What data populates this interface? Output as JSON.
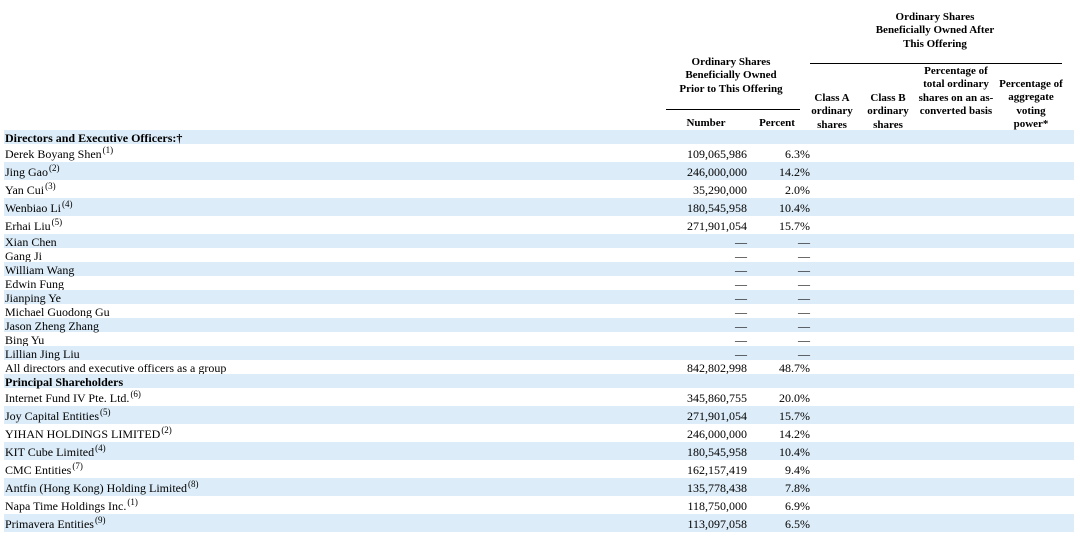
{
  "headers": {
    "prior_group": "Ordinary Shares Beneficially Owned Prior to This Offering",
    "after_group": "Ordinary Shares Beneficially Owned After This Offering",
    "number": "Number",
    "percent": "Percent",
    "class_a": "Class A ordinary shares",
    "class_b": "Class B ordinary shares",
    "pct_total": "Percentage of total ordinary shares on an as-converted basis",
    "pct_voting": "Percentage of aggregate voting power*"
  },
  "rows": [
    {
      "name": "Directors and Executive Officers:†",
      "section": true
    },
    {
      "name": "Derek Boyang Shen",
      "note": "(1)",
      "number": "109,065,986",
      "percent": "6.3%"
    },
    {
      "name": "Jing Gao",
      "note": "(2)",
      "number": "246,000,000",
      "percent": "14.2%"
    },
    {
      "name": "Yan Cui",
      "note": "(3)",
      "number": "35,290,000",
      "percent": "2.0%"
    },
    {
      "name": "Wenbiao Li",
      "note": "(4)",
      "number": "180,545,958",
      "percent": "10.4%"
    },
    {
      "name": "Erhai Liu",
      "note": "(5)",
      "number": "271,901,054",
      "percent": "15.7%"
    },
    {
      "name": "Xian Chen",
      "number": "—",
      "percent": "—"
    },
    {
      "name": "Gang Ji",
      "number": "—",
      "percent": "—"
    },
    {
      "name": "William Wang",
      "number": "—",
      "percent": "—"
    },
    {
      "name": "Edwin Fung",
      "number": "—",
      "percent": "—"
    },
    {
      "name": "Jianping Ye",
      "number": "—",
      "percent": "—"
    },
    {
      "name": "Michael Guodong Gu",
      "number": "—",
      "percent": "—"
    },
    {
      "name": "Jason Zheng Zhang",
      "number": "—",
      "percent": "—"
    },
    {
      "name": "Bing Yu",
      "number": "—",
      "percent": "—"
    },
    {
      "name": "Lillian Jing Liu",
      "number": "—",
      "percent": "—"
    },
    {
      "name": "All directors and executive officers as a group",
      "number": "842,802,998",
      "percent": "48.7%"
    },
    {
      "name": "Principal Shareholders",
      "section": true
    },
    {
      "name": "Internet Fund IV Pte. Ltd.",
      "note": "(6)",
      "number": "345,860,755",
      "percent": "20.0%"
    },
    {
      "name": "Joy Capital Entities",
      "note": "(5)",
      "number": "271,901,054",
      "percent": "15.7%"
    },
    {
      "name": "YIHAN HOLDINGS LIMITED",
      "note": "(2)",
      "number": "246,000,000",
      "percent": "14.2%"
    },
    {
      "name": "KIT Cube Limited",
      "note": "(4)",
      "number": "180,545,958",
      "percent": "10.4%"
    },
    {
      "name": "CMC Entities",
      "note": "(7)",
      "number": "162,157,419",
      "percent": "9.4%"
    },
    {
      "name": "Antfin (Hong Kong) Holding Limited",
      "note": "(8)",
      "number": "135,778,438",
      "percent": "7.8%"
    },
    {
      "name": "Napa Time Holdings Inc.",
      "note": "(1)",
      "number": "118,750,000",
      "percent": "6.9%"
    },
    {
      "name": "Primavera Entities",
      "note": "(9)",
      "number": "113,097,058",
      "percent": "6.5%"
    }
  ]
}
